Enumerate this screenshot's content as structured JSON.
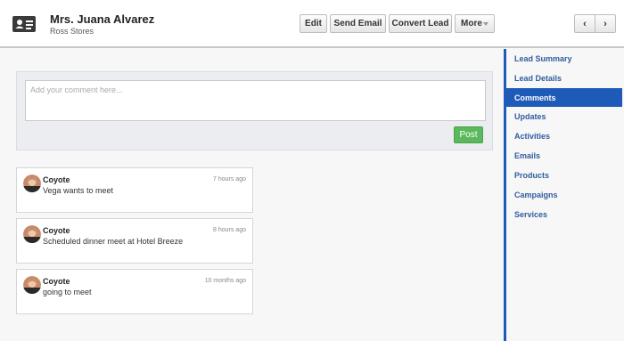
{
  "header": {
    "title": "Mrs. Juana Alvarez",
    "subtitle": "Ross Stores",
    "icon": "contact-card-icon"
  },
  "actions": {
    "edit": "Edit",
    "send_email": "Send Email",
    "convert_lead": "Convert Lead",
    "more": "More"
  },
  "nav": {
    "prev": "‹",
    "next": "›"
  },
  "comment_box": {
    "placeholder": "Add your comment here...",
    "value": "",
    "post_label": "Post"
  },
  "comments": [
    {
      "author": "Coyote",
      "time": "7 hours ago",
      "text": "Vega wants to meet"
    },
    {
      "author": "Coyote",
      "time": "8 hours ago",
      "text": "Scheduled dinner meet at Hotel Breeze"
    },
    {
      "author": "Coyote",
      "time": "10 months ago",
      "text": "going to meet"
    }
  ],
  "sidebar": {
    "items": [
      {
        "label": "Lead Summary",
        "active": false
      },
      {
        "label": "Lead Details",
        "active": false
      },
      {
        "label": "Comments",
        "active": true
      },
      {
        "label": "Updates",
        "active": false
      },
      {
        "label": "Activities",
        "active": false
      },
      {
        "label": "Emails",
        "active": false
      },
      {
        "label": "Products",
        "active": false
      },
      {
        "label": "Campaigns",
        "active": false
      },
      {
        "label": "Services",
        "active": false
      }
    ]
  },
  "colors": {
    "accent": "#1e5bb8",
    "post_button": "#5cb85c",
    "link": "#2f5d9f"
  }
}
